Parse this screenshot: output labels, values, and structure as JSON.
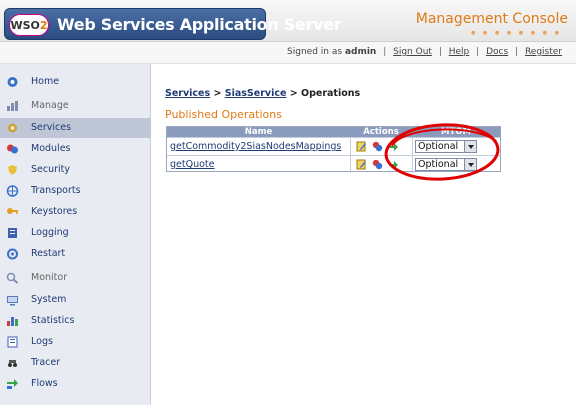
{
  "header": {
    "logo_text_1": "WSO",
    "logo_text_2": "2",
    "app_title": "Web Services Application Server",
    "console_title": "Management Console",
    "console_dots": "● ● ● ● ● ● ● ●"
  },
  "topbar": {
    "signed_in_label": "Signed in as",
    "user": "admin",
    "sign_out": "Sign Out",
    "help": "Help",
    "docs": "Docs",
    "register": "Register",
    "separator": "|"
  },
  "sidebar": {
    "items": [
      {
        "label": "Home",
        "icon": "home-icon"
      },
      {
        "label": "Manage",
        "icon": "manage-icon"
      },
      {
        "label": "Services",
        "icon": "services-icon"
      },
      {
        "label": "Modules",
        "icon": "modules-icon"
      },
      {
        "label": "Security",
        "icon": "security-icon"
      },
      {
        "label": "Transports",
        "icon": "transports-icon"
      },
      {
        "label": "Keystores",
        "icon": "keystores-icon"
      },
      {
        "label": "Logging",
        "icon": "logging-icon"
      },
      {
        "label": "Restart",
        "icon": "restart-icon"
      },
      {
        "label": "Monitor",
        "icon": "monitor-icon"
      },
      {
        "label": "System",
        "icon": "system-icon"
      },
      {
        "label": "Statistics",
        "icon": "statistics-icon"
      },
      {
        "label": "Logs",
        "icon": "logs-icon"
      },
      {
        "label": "Tracer",
        "icon": "tracer-icon"
      },
      {
        "label": "Flows",
        "icon": "flows-icon"
      }
    ],
    "active": "Services"
  },
  "breadcrumb": {
    "services": "Services",
    "sep1": ">",
    "service": "SiasService",
    "sep2": ">",
    "current": "Operations"
  },
  "main": {
    "section_title": "Published Operations",
    "table": {
      "headers": [
        "Name",
        "Actions",
        "MTOM"
      ],
      "rows": [
        {
          "name": "getCommodity2SiasNodesMappings",
          "mtom": "Optional"
        },
        {
          "name": "getQuote",
          "mtom": "Optional"
        }
      ]
    }
  },
  "colors": {
    "accent_orange": "#e07a16",
    "link_blue": "#1f3b74",
    "table_header": "#8a9bbd",
    "annotation_red": "#e00000"
  }
}
